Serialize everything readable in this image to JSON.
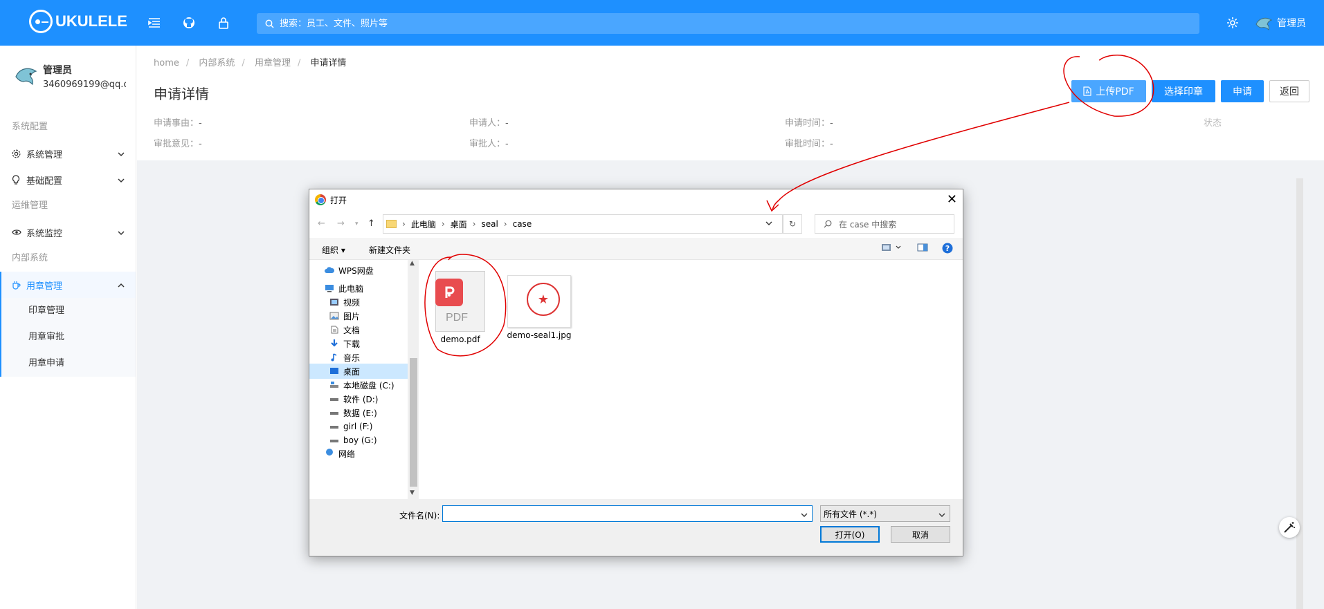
{
  "header": {
    "logo_text": "UKULELE",
    "search_placeholder": "搜索：员工、文件、照片等",
    "user_name": "管理员"
  },
  "sidebar": {
    "profile": {
      "name": "管理员",
      "email": "3460969199@qq.c"
    },
    "groups": [
      {
        "title": "系统配置"
      },
      {
        "title": "运维管理"
      },
      {
        "title": "内部系统"
      }
    ],
    "items": {
      "system_mgmt": "系统管理",
      "basic_config": "基础配置",
      "system_monitor": "系统监控",
      "seal_mgmt": "用章管理",
      "seal_admin": "印章管理",
      "seal_review": "用章审批",
      "seal_apply": "用章申请"
    }
  },
  "breadcrumb": [
    "home",
    "内部系统",
    "用章管理",
    "申请详情"
  ],
  "page": {
    "title": "申请详情",
    "buttons": {
      "upload": "上传PDF",
      "select_seal": "选择印章",
      "apply": "申请",
      "back": "返回"
    },
    "fields": {
      "reason": {
        "label": "申请事由：",
        "value": "-"
      },
      "applicant": {
        "label": "申请人：",
        "value": "-"
      },
      "apply_time": {
        "label": "申请时间：",
        "value": "-"
      },
      "status": {
        "label": "状态",
        "value": ""
      },
      "opinion": {
        "label": "审批意见：",
        "value": "-"
      },
      "approver": {
        "label": "审批人：",
        "value": "-"
      },
      "approve_time": {
        "label": "审批时间：",
        "value": "-"
      }
    }
  },
  "dialog": {
    "title": "打开",
    "path": [
      "此电脑",
      "桌面",
      "seal",
      "case"
    ],
    "search_placeholder": "在 case 中搜索",
    "toolbar": {
      "organize": "组织",
      "new_folder": "新建文件夹"
    },
    "tree": [
      "WPS网盘",
      "此电脑",
      "视频",
      "图片",
      "文档",
      "下载",
      "音乐",
      "桌面",
      "本地磁盘 (C:)",
      "软件 (D:)",
      "数据 (E:)",
      "girl (F:)",
      "boy (G:)",
      "网络"
    ],
    "selected_tree_item": "桌面",
    "files": [
      {
        "name": "demo.pdf",
        "icon": "pdf-file-icon"
      },
      {
        "name": "demo-seal1.jpg",
        "icon": "seal-image-icon"
      }
    ],
    "filename_label": "文件名(N):",
    "filename_value": "",
    "filetype": "所有文件 (*.*)",
    "open_button": "打开(O)",
    "cancel_button": "取消"
  },
  "colors": {
    "primary": "#1e90ff",
    "annotation": "#e00000"
  }
}
